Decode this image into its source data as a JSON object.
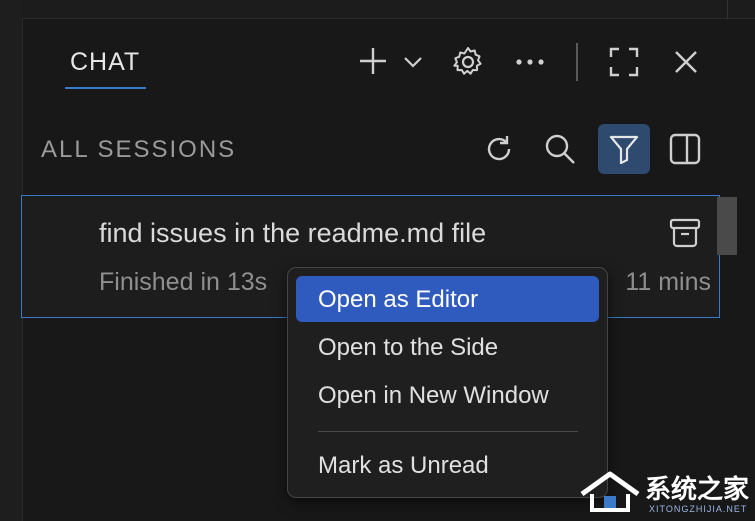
{
  "header": {
    "tab_label": "CHAT"
  },
  "sessions": {
    "label": "ALL SESSIONS"
  },
  "session": {
    "title": "find issues in the readme.md file",
    "status": "Finished in 13s",
    "time": "11 mins"
  },
  "context_menu": {
    "items": [
      {
        "label": "Open as Editor"
      },
      {
        "label": "Open to the Side"
      },
      {
        "label": "Open in New Window"
      },
      {
        "label": "Mark as Unread"
      }
    ]
  },
  "watermark": {
    "text": "系统之家",
    "subtext": "XITONGZHIJIA.NET"
  },
  "colors": {
    "accent": "#3b79c9",
    "menu_active": "#2f5bbf",
    "filter_active": "#2e4a6e"
  }
}
